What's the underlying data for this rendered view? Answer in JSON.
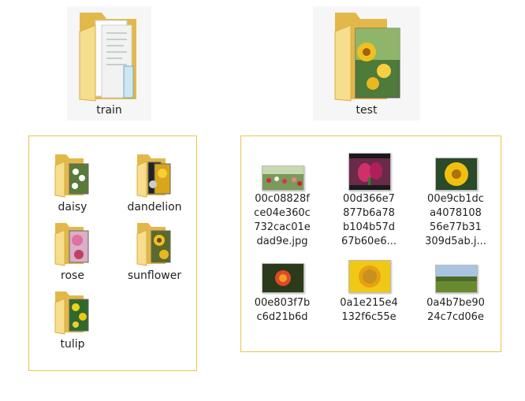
{
  "top_folders": [
    {
      "name": "train",
      "icon": "documents-folder-icon"
    },
    {
      "name": "test",
      "icon": "image-folder-icon"
    }
  ],
  "train_folders": [
    {
      "name": "daisy",
      "icon": "daisy-folder-icon"
    },
    {
      "name": "dandelion",
      "icon": "dandelion-folder-icon"
    },
    {
      "name": "rose",
      "icon": "rose-folder-icon"
    },
    {
      "name": "sunflower",
      "icon": "sunflower-folder-icon"
    },
    {
      "name": "tulip",
      "icon": "tulip-folder-icon"
    }
  ],
  "test_files": [
    {
      "line1": "00c08828f",
      "line2": "ce04e360c",
      "line3": "732cac01e",
      "line4": "dad9e.jpg"
    },
    {
      "line1": "00d366e7",
      "line2": "877b6a78",
      "line3": "b104b57d",
      "line4": "67b60e6..."
    },
    {
      "line1": "00e9cb1dc",
      "line2": "a4078108",
      "line3": "56e77b31",
      "line4": "309d5ab.j..."
    },
    {
      "line1": "00e803f7b",
      "line2": "c6d21b6d"
    },
    {
      "line1": "0a1e215e4",
      "line2": "132f6c55e"
    },
    {
      "line1": "0a4b7be90",
      "line2": "24c7cd06e"
    }
  ],
  "colors": {
    "folder": "#f5d77e",
    "folder_dark": "#e3b84a",
    "panel_border": "#e8c54a"
  }
}
